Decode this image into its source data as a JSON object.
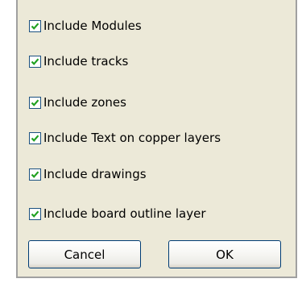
{
  "options": [
    {
      "label": "Include Modules",
      "checked": true
    },
    {
      "label": "Include tracks",
      "checked": true
    },
    {
      "label": "Include zones",
      "checked": true
    },
    {
      "label": "Include Text on copper layers",
      "checked": true
    },
    {
      "label": "Include drawings",
      "checked": true
    },
    {
      "label": "Include board outline layer",
      "checked": true
    }
  ],
  "buttons": {
    "cancel_label": "Cancel",
    "ok_label": "OK"
  },
  "colors": {
    "dialog_background": "#ece9d8",
    "check_mark": "#21a121",
    "button_border": "#003c74"
  }
}
